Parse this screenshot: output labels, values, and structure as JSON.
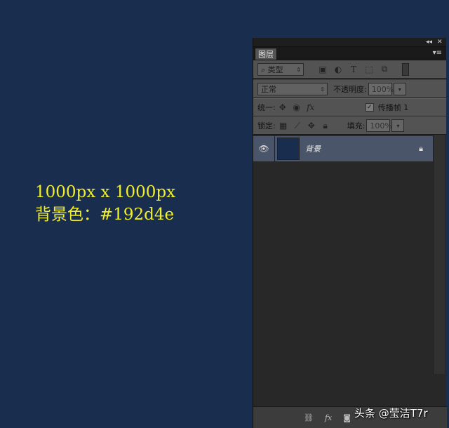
{
  "canvas_info": {
    "line1": "1000px x 1000px",
    "line2": "背景色：#192d4e"
  },
  "panel": {
    "collapse_icon": "double-chevron",
    "close_icon": "close",
    "tab_label": "图层",
    "menu_icon": "panel-menu",
    "filter": {
      "kind_label": "类型",
      "icons": [
        "image-filter-icon",
        "adjustment-filter-icon",
        "type-filter-icon",
        "shape-filter-icon",
        "smart-object-filter-icon"
      ],
      "toggle": "filter-toggle"
    },
    "blend": {
      "mode": "正常",
      "opacity_label": "不透明度:",
      "opacity_value": "100%"
    },
    "unify": {
      "label": "统一:",
      "propagate_label": "传播帧 1"
    },
    "lock": {
      "label": "锁定:",
      "fill_label": "填充:",
      "fill_value": "100%"
    },
    "layers": [
      {
        "name": "背景",
        "visible": true,
        "locked": true,
        "thumb_color": "#192d4e"
      }
    ],
    "bottom_icons": [
      "link-layers-icon",
      "fx-icon",
      "mask-icon"
    ]
  },
  "watermark": "头条 @莹洁T7r",
  "colors": {
    "canvas_bg": "#192d4e",
    "text_yellow": "#f1ee2c",
    "selected_layer": "#4b5569"
  }
}
